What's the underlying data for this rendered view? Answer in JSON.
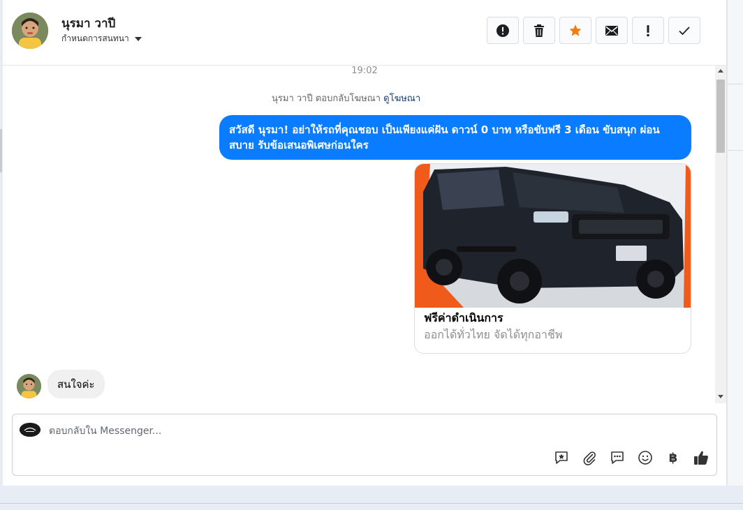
{
  "header": {
    "contact_name": "นุรมา วาปี",
    "assign_label": "กำหนดการสนทนา",
    "actions": [
      {
        "icon": "alert-circle-icon"
      },
      {
        "icon": "trash-icon"
      },
      {
        "icon": "star-icon",
        "color": "#f27d0c"
      },
      {
        "icon": "envelope-icon"
      },
      {
        "icon": "exclamation-icon"
      },
      {
        "icon": "check-icon"
      }
    ]
  },
  "chat": {
    "timestamp": "19:02",
    "reply_note_prefix": "นุรมา วาปี ตอบกลับโฆษณา",
    "reply_note_link": "ดูโฆษณา",
    "outgoing_message": "สวัสดี นุรมา! อย่าให้รถที่คุณชอบ เป็นเพียงแค่ฝัน ดาวน์ 0 บาท หรือขับฟรี 3 เดือน ขับสนุก ผ่อนสบาย รับข้อเสนอพิเศษก่อนใคร",
    "ad_card": {
      "title": "ฟรีค่าดำเนินการ",
      "subtitle": "ออกได้ทั่วไทย จัดได้ทุกอาชีพ"
    },
    "incoming_message": "สนใจค่ะ"
  },
  "composer": {
    "placeholder": "ตอบกลับใน Messenger...",
    "tools": [
      "saved-reply-icon",
      "attachment-icon",
      "chat-bubble-icon",
      "emoji-icon",
      "baht-icon",
      "thumbs-up-icon"
    ],
    "baht_symbol": "฿"
  },
  "colors": {
    "accent_blue": "#0a7cff",
    "star_orange": "#f27d0c"
  }
}
